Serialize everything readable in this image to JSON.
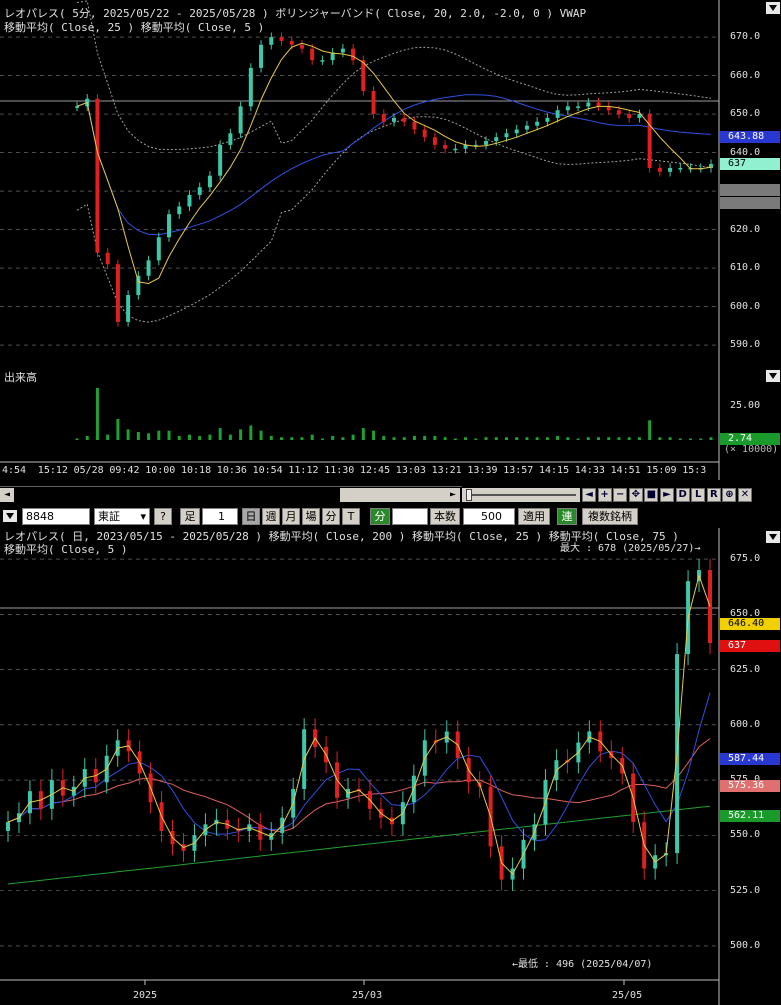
{
  "top_chart": {
    "title_line1": "レオパレス( 5分, 2025/05/22 - 2025/05/28 )   ボリンジャーバンド( Close, 20, 2.0, -2.0, 0 )   VWAP",
    "title_line2": "移動平均( Close, 25 )   移動平均( Close, 5 )",
    "y_ticks": [
      "670.0",
      "660.0",
      "650.0",
      "640.0",
      "630.0",
      "620.0",
      "610.0",
      "600.0",
      "590.0"
    ],
    "price_tags": {
      "ma25": "643.88",
      "last": "637",
      "band_upper": "",
      "band_lower": ""
    },
    "volume_label": "出来高",
    "volume_tick": "25.00",
    "volume_tag": "2.74",
    "volume_unit": "(× 10000)",
    "x_ticks": [
      "4:54",
      "15:12",
      "05/28",
      "09:42",
      "10:00",
      "10:18",
      "10:36",
      "10:54",
      "11:12",
      "11:30",
      "12:45",
      "13:03",
      "13:21",
      "13:39",
      "13:57",
      "14:15",
      "14:33",
      "14:51",
      "15:09",
      "15:3"
    ]
  },
  "nav_buttons": [
    "◄",
    "+",
    "−",
    "✥",
    "■",
    "►",
    "D",
    "L",
    "R",
    "⊕",
    "✕"
  ],
  "toolbar": {
    "code": "8848",
    "market": "東証",
    "help": "?",
    "ashi_label": "足",
    "ashi_value": "1",
    "day": "日",
    "week": "週",
    "month": "月",
    "ba": "場",
    "fun": "分",
    "t": "T",
    "fun2": "分",
    "honsu_label": "本数",
    "honsu_value": "500",
    "apply": "適用",
    "ren": "連",
    "multi": "複数銘柄"
  },
  "bottom_chart": {
    "title_line1": "レオパレス( 日, 2023/05/15 - 2025/05/28 )   移動平均( Close, 200 )   移動平均( Close, 25 )   移動平均( Close, 75 )",
    "title_line2": "移動平均( Close, 5 )",
    "max_label": "最大 : 678 (2025/05/27)→",
    "min_label": "←最低 : 496 (2025/04/07)",
    "y_ticks": [
      "675.0",
      "650.0",
      "625.0",
      "600.0",
      "575.0",
      "550.0",
      "525.0",
      "500.0"
    ],
    "price_tags": {
      "ma5": "646.40",
      "last": "637",
      "ma25": "587.44",
      "ma75": "575.36",
      "ma200": "562.11"
    },
    "x_ticks": [
      "2025",
      "25/03",
      "25/05"
    ]
  },
  "colors": {
    "up": "#3ec8a8",
    "down": "#e02020",
    "ma5": "#e8c848",
    "ma25": "#3050e0",
    "ma75": "#e06060",
    "ma200": "#20a030",
    "band": "#a0a0a0",
    "vwap": "#c0c0c0",
    "grid": "#808080"
  },
  "chart_data": [
    {
      "type": "candlestick",
      "title": "レオパレス( 5分, 2025/05/22 - 2025/05/28 )",
      "ylim": [
        583,
        676
      ],
      "series": [
        {
          "name": "Close",
          "values": [
            652,
            654,
            614,
            611,
            596,
            603,
            608,
            612,
            618,
            624,
            626,
            629,
            631,
            634,
            642,
            645,
            652,
            662,
            668,
            670,
            669,
            668,
            667,
            664,
            664,
            666,
            667,
            664,
            656,
            650,
            648,
            649,
            648,
            646,
            644,
            642,
            641,
            641,
            642,
            642,
            643,
            644,
            645,
            646,
            647,
            648,
            649,
            651,
            652,
            652,
            653,
            652,
            651,
            650,
            649,
            650,
            636,
            635,
            636,
            636,
            636,
            636,
            637
          ]
        }
      ]
    },
    {
      "type": "candlestick",
      "title": "レオパレス( 日, 2023/05/15 - 2025/05/28 )",
      "ylim": [
        490,
        680
      ],
      "series": [
        {
          "name": "Close",
          "values": [
            556,
            560,
            570,
            562,
            575,
            568,
            572,
            580,
            574,
            586,
            593,
            588,
            578,
            565,
            552,
            546,
            543,
            550,
            555,
            557,
            553,
            552,
            555,
            548,
            551,
            558,
            571,
            598,
            590,
            583,
            567,
            571,
            570,
            562,
            558,
            555,
            565,
            577,
            593,
            592,
            597,
            585,
            574,
            572,
            545,
            530,
            535,
            548,
            555,
            575,
            584,
            583,
            592,
            597,
            588,
            585,
            578,
            556,
            535,
            541,
            542,
            632,
            665,
            670,
            637
          ]
        }
      ]
    }
  ]
}
